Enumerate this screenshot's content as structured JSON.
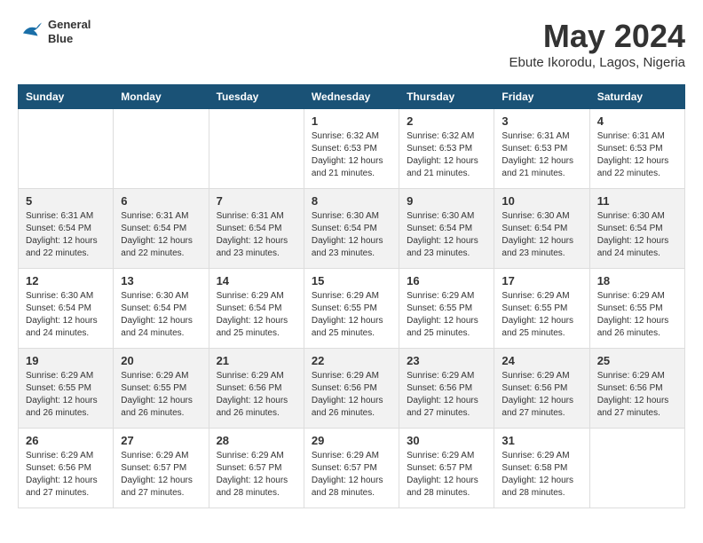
{
  "header": {
    "logo_line1": "General",
    "logo_line2": "Blue",
    "month_year": "May 2024",
    "location": "Ebute Ikorodu, Lagos, Nigeria"
  },
  "calendar": {
    "days_of_week": [
      "Sunday",
      "Monday",
      "Tuesday",
      "Wednesday",
      "Thursday",
      "Friday",
      "Saturday"
    ],
    "weeks": [
      [
        {
          "day": "",
          "info": ""
        },
        {
          "day": "",
          "info": ""
        },
        {
          "day": "",
          "info": ""
        },
        {
          "day": "1",
          "info": "Sunrise: 6:32 AM\nSunset: 6:53 PM\nDaylight: 12 hours\nand 21 minutes."
        },
        {
          "day": "2",
          "info": "Sunrise: 6:32 AM\nSunset: 6:53 PM\nDaylight: 12 hours\nand 21 minutes."
        },
        {
          "day": "3",
          "info": "Sunrise: 6:31 AM\nSunset: 6:53 PM\nDaylight: 12 hours\nand 21 minutes."
        },
        {
          "day": "4",
          "info": "Sunrise: 6:31 AM\nSunset: 6:53 PM\nDaylight: 12 hours\nand 22 minutes."
        }
      ],
      [
        {
          "day": "5",
          "info": "Sunrise: 6:31 AM\nSunset: 6:54 PM\nDaylight: 12 hours\nand 22 minutes."
        },
        {
          "day": "6",
          "info": "Sunrise: 6:31 AM\nSunset: 6:54 PM\nDaylight: 12 hours\nand 22 minutes."
        },
        {
          "day": "7",
          "info": "Sunrise: 6:31 AM\nSunset: 6:54 PM\nDaylight: 12 hours\nand 23 minutes."
        },
        {
          "day": "8",
          "info": "Sunrise: 6:30 AM\nSunset: 6:54 PM\nDaylight: 12 hours\nand 23 minutes."
        },
        {
          "day": "9",
          "info": "Sunrise: 6:30 AM\nSunset: 6:54 PM\nDaylight: 12 hours\nand 23 minutes."
        },
        {
          "day": "10",
          "info": "Sunrise: 6:30 AM\nSunset: 6:54 PM\nDaylight: 12 hours\nand 23 minutes."
        },
        {
          "day": "11",
          "info": "Sunrise: 6:30 AM\nSunset: 6:54 PM\nDaylight: 12 hours\nand 24 minutes."
        }
      ],
      [
        {
          "day": "12",
          "info": "Sunrise: 6:30 AM\nSunset: 6:54 PM\nDaylight: 12 hours\nand 24 minutes."
        },
        {
          "day": "13",
          "info": "Sunrise: 6:30 AM\nSunset: 6:54 PM\nDaylight: 12 hours\nand 24 minutes."
        },
        {
          "day": "14",
          "info": "Sunrise: 6:29 AM\nSunset: 6:54 PM\nDaylight: 12 hours\nand 25 minutes."
        },
        {
          "day": "15",
          "info": "Sunrise: 6:29 AM\nSunset: 6:55 PM\nDaylight: 12 hours\nand 25 minutes."
        },
        {
          "day": "16",
          "info": "Sunrise: 6:29 AM\nSunset: 6:55 PM\nDaylight: 12 hours\nand 25 minutes."
        },
        {
          "day": "17",
          "info": "Sunrise: 6:29 AM\nSunset: 6:55 PM\nDaylight: 12 hours\nand 25 minutes."
        },
        {
          "day": "18",
          "info": "Sunrise: 6:29 AM\nSunset: 6:55 PM\nDaylight: 12 hours\nand 26 minutes."
        }
      ],
      [
        {
          "day": "19",
          "info": "Sunrise: 6:29 AM\nSunset: 6:55 PM\nDaylight: 12 hours\nand 26 minutes."
        },
        {
          "day": "20",
          "info": "Sunrise: 6:29 AM\nSunset: 6:55 PM\nDaylight: 12 hours\nand 26 minutes."
        },
        {
          "day": "21",
          "info": "Sunrise: 6:29 AM\nSunset: 6:56 PM\nDaylight: 12 hours\nand 26 minutes."
        },
        {
          "day": "22",
          "info": "Sunrise: 6:29 AM\nSunset: 6:56 PM\nDaylight: 12 hours\nand 26 minutes."
        },
        {
          "day": "23",
          "info": "Sunrise: 6:29 AM\nSunset: 6:56 PM\nDaylight: 12 hours\nand 27 minutes."
        },
        {
          "day": "24",
          "info": "Sunrise: 6:29 AM\nSunset: 6:56 PM\nDaylight: 12 hours\nand 27 minutes."
        },
        {
          "day": "25",
          "info": "Sunrise: 6:29 AM\nSunset: 6:56 PM\nDaylight: 12 hours\nand 27 minutes."
        }
      ],
      [
        {
          "day": "26",
          "info": "Sunrise: 6:29 AM\nSunset: 6:56 PM\nDaylight: 12 hours\nand 27 minutes."
        },
        {
          "day": "27",
          "info": "Sunrise: 6:29 AM\nSunset: 6:57 PM\nDaylight: 12 hours\nand 27 minutes."
        },
        {
          "day": "28",
          "info": "Sunrise: 6:29 AM\nSunset: 6:57 PM\nDaylight: 12 hours\nand 28 minutes."
        },
        {
          "day": "29",
          "info": "Sunrise: 6:29 AM\nSunset: 6:57 PM\nDaylight: 12 hours\nand 28 minutes."
        },
        {
          "day": "30",
          "info": "Sunrise: 6:29 AM\nSunset: 6:57 PM\nDaylight: 12 hours\nand 28 minutes."
        },
        {
          "day": "31",
          "info": "Sunrise: 6:29 AM\nSunset: 6:58 PM\nDaylight: 12 hours\nand 28 minutes."
        },
        {
          "day": "",
          "info": ""
        }
      ]
    ]
  }
}
